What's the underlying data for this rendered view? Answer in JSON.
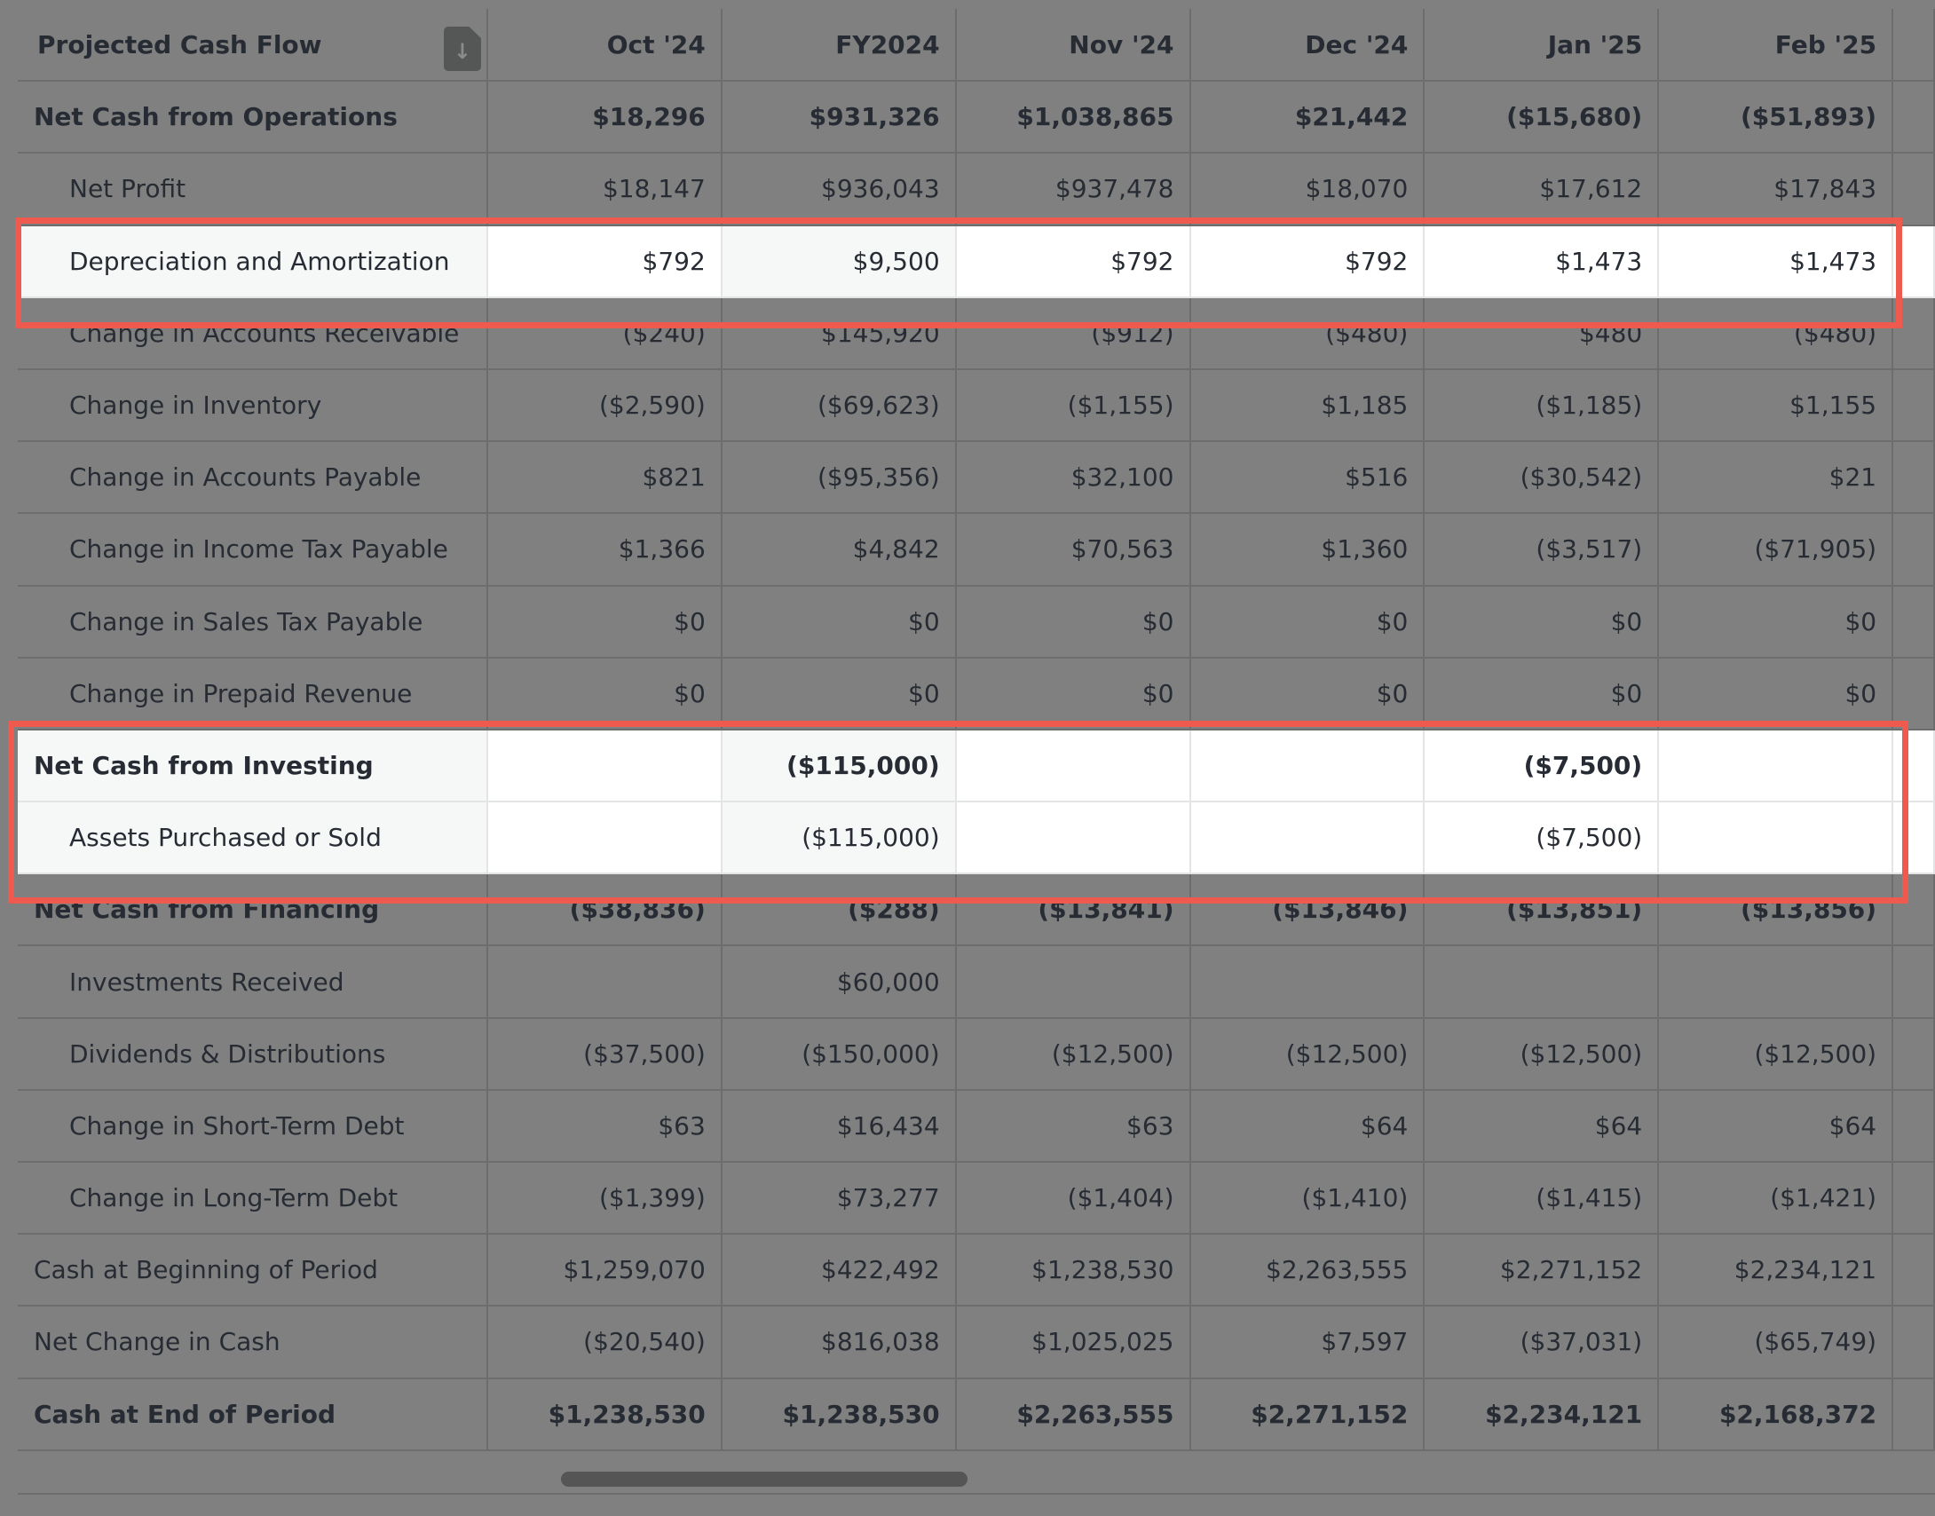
{
  "table": {
    "title": "Projected Cash Flow",
    "download_icon": "download-file-icon",
    "columns": [
      "Oct '24",
      "FY2024",
      "Nov '24",
      "Dec '24",
      "Jan '25",
      "Feb '25"
    ],
    "rows": [
      {
        "label": "Net Cash from Operations",
        "indent": false,
        "bold": true,
        "values": [
          "$18,296",
          "$931,326",
          "$1,038,865",
          "$21,442",
          "($15,680)",
          "($51,893)"
        ]
      },
      {
        "label": "Net Profit",
        "indent": true,
        "bold": false,
        "values": [
          "$18,147",
          "$936,043",
          "$937,478",
          "$18,070",
          "$17,612",
          "$17,843"
        ]
      },
      {
        "label": "Depreciation and Amortization",
        "indent": true,
        "bold": false,
        "highlight": true,
        "values": [
          "$792",
          "$9,500",
          "$792",
          "$792",
          "$1,473",
          "$1,473"
        ]
      },
      {
        "label": "Change in Accounts Receivable",
        "indent": true,
        "bold": false,
        "values": [
          "($240)",
          "$145,920",
          "($912)",
          "($480)",
          "$480",
          "($480)"
        ]
      },
      {
        "label": "Change in Inventory",
        "indent": true,
        "bold": false,
        "values": [
          "($2,590)",
          "($69,623)",
          "($1,155)",
          "$1,185",
          "($1,185)",
          "$1,155"
        ]
      },
      {
        "label": "Change in Accounts Payable",
        "indent": true,
        "bold": false,
        "values": [
          "$821",
          "($95,356)",
          "$32,100",
          "$516",
          "($30,542)",
          "$21"
        ]
      },
      {
        "label": "Change in Income Tax Payable",
        "indent": true,
        "bold": false,
        "values": [
          "$1,366",
          "$4,842",
          "$70,563",
          "$1,360",
          "($3,517)",
          "($71,905)"
        ]
      },
      {
        "label": "Change in Sales Tax Payable",
        "indent": true,
        "bold": false,
        "values": [
          "$0",
          "$0",
          "$0",
          "$0",
          "$0",
          "$0"
        ]
      },
      {
        "label": "Change in Prepaid Revenue",
        "indent": true,
        "bold": false,
        "values": [
          "$0",
          "$0",
          "$0",
          "$0",
          "$0",
          "$0"
        ]
      },
      {
        "label": "Net Cash from Investing",
        "indent": false,
        "bold": true,
        "highlight": true,
        "values": [
          "",
          "($115,000)",
          "",
          "",
          "($7,500)",
          ""
        ]
      },
      {
        "label": "Assets Purchased or Sold",
        "indent": true,
        "bold": false,
        "highlight": true,
        "values": [
          "",
          "($115,000)",
          "",
          "",
          "($7,500)",
          ""
        ]
      },
      {
        "label": "Net Cash from Financing",
        "indent": false,
        "bold": true,
        "values": [
          "($38,836)",
          "($288)",
          "($13,841)",
          "($13,846)",
          "($13,851)",
          "($13,856)"
        ]
      },
      {
        "label": "Investments Received",
        "indent": true,
        "bold": false,
        "values": [
          "",
          "$60,000",
          "",
          "",
          "",
          ""
        ]
      },
      {
        "label": "Dividends & Distributions",
        "indent": true,
        "bold": false,
        "values": [
          "($37,500)",
          "($150,000)",
          "($12,500)",
          "($12,500)",
          "($12,500)",
          "($12,500)"
        ]
      },
      {
        "label": "Change in Short-Term Debt",
        "indent": true,
        "bold": false,
        "values": [
          "$63",
          "$16,434",
          "$63",
          "$64",
          "$64",
          "$64"
        ]
      },
      {
        "label": "Change in Long-Term Debt",
        "indent": true,
        "bold": false,
        "values": [
          "($1,399)",
          "$73,277",
          "($1,404)",
          "($1,410)",
          "($1,415)",
          "($1,421)"
        ]
      },
      {
        "label": "Cash at Beginning of Period",
        "indent": false,
        "bold": false,
        "values": [
          "$1,259,070",
          "$422,492",
          "$1,238,530",
          "$2,263,555",
          "$2,271,152",
          "$2,234,121"
        ]
      },
      {
        "label": "Net Change in Cash",
        "indent": false,
        "bold": false,
        "values": [
          "($20,540)",
          "$816,038",
          "$1,025,025",
          "$7,597",
          "($37,031)",
          "($65,749)"
        ]
      },
      {
        "label": "Cash at End of Period",
        "indent": false,
        "bold": true,
        "values": [
          "$1,238,530",
          "$1,238,530",
          "$2,263,555",
          "$2,271,152",
          "$2,234,121",
          "$2,168,372"
        ]
      }
    ]
  },
  "highlight_color": "#ef5a4f"
}
